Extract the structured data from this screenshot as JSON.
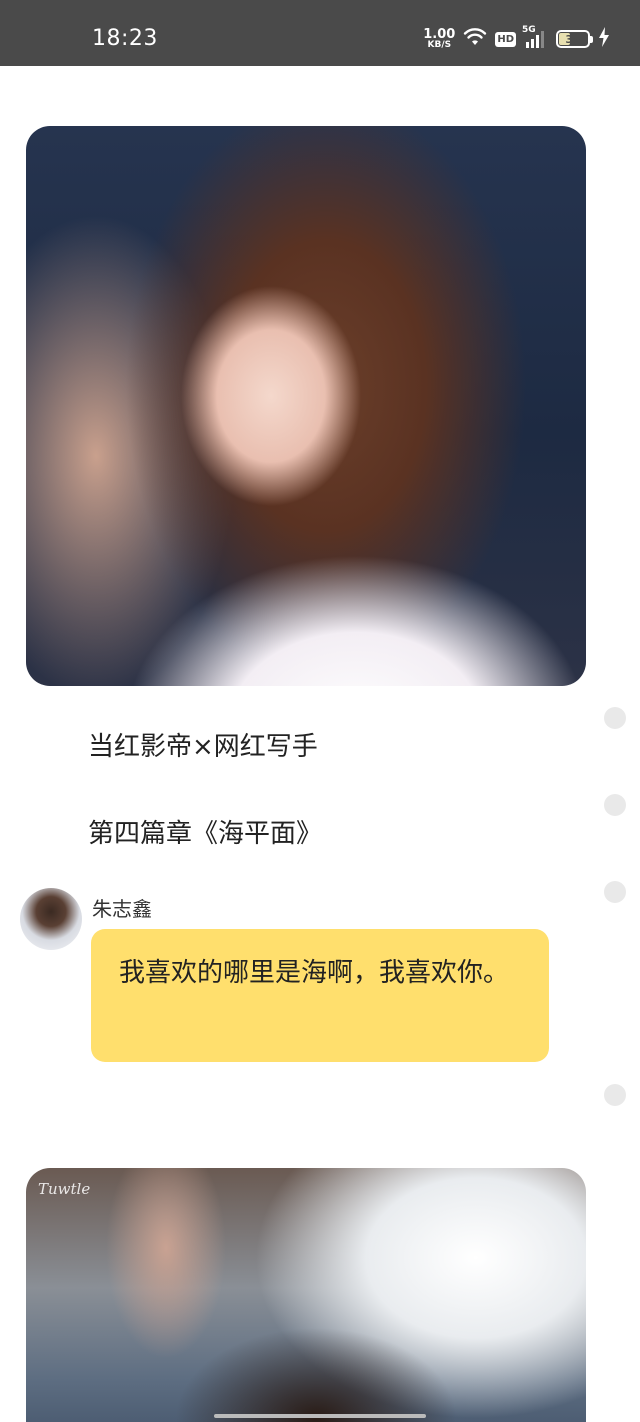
{
  "status_bar": {
    "time": "18:23",
    "net_speed_value": "1.00",
    "net_speed_unit": "KB/S",
    "hd_label": "HD",
    "network_label": "5G",
    "battery_level": "38",
    "battery_percent": 38,
    "icons": [
      "wifi-icon",
      "signal-icon",
      "battery-icon",
      "charging-icon"
    ]
  },
  "post": {
    "line_1": "当红影帝×网红写手",
    "line_2": "第四篇章《海平面》",
    "photo_2_watermark": "Tuwtle"
  },
  "chat": {
    "sender_name": "朱志鑫",
    "message": "我喜欢的哪里是海啊，我喜欢你。",
    "bubble_color": "#ffdf6d"
  }
}
